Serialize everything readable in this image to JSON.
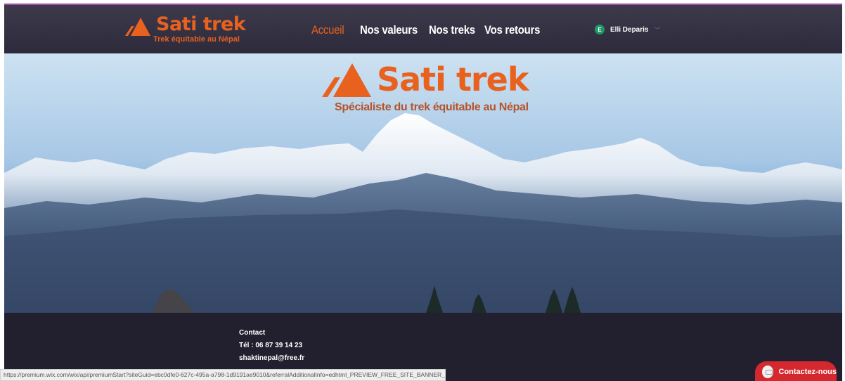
{
  "header": {
    "logo_name": "Sati trek",
    "logo_tagline": "Trek équitable au Népal",
    "nav": [
      {
        "label": "Accueil",
        "active": true
      },
      {
        "label": "Nos valeurs",
        "active": false
      },
      {
        "label": "Nos treks",
        "active": false
      },
      {
        "label": "Vos retours",
        "active": false
      }
    ],
    "user": {
      "initial": "E",
      "name": "Elli Deparis"
    }
  },
  "hero": {
    "title": "Sati trek",
    "subtitle": "Spécialiste du trek équitable au Népal"
  },
  "footer": {
    "contact_heading": "Contact",
    "phone": "Tél : 06 87 39 14 23",
    "email": "shaktinepal@free.fr"
  },
  "status_bar_url": "https://premium.wix.com/wix/api/premiumStart?siteGuid=ebc0dfe0-627c-495a-a798-1d9191ae9010&referralAdditionalInfo=edhtml_PREVIEW_FREE_SITE_BANNER_CLICK",
  "contact_button": {
    "label": "Contactez-nous",
    "icon": "chat-bubble-icon"
  },
  "colors": {
    "accent": "#e8611f",
    "header_bg": "#2d2a3b",
    "footer_bg": "#22202f",
    "contact_btn": "#d4282e"
  }
}
